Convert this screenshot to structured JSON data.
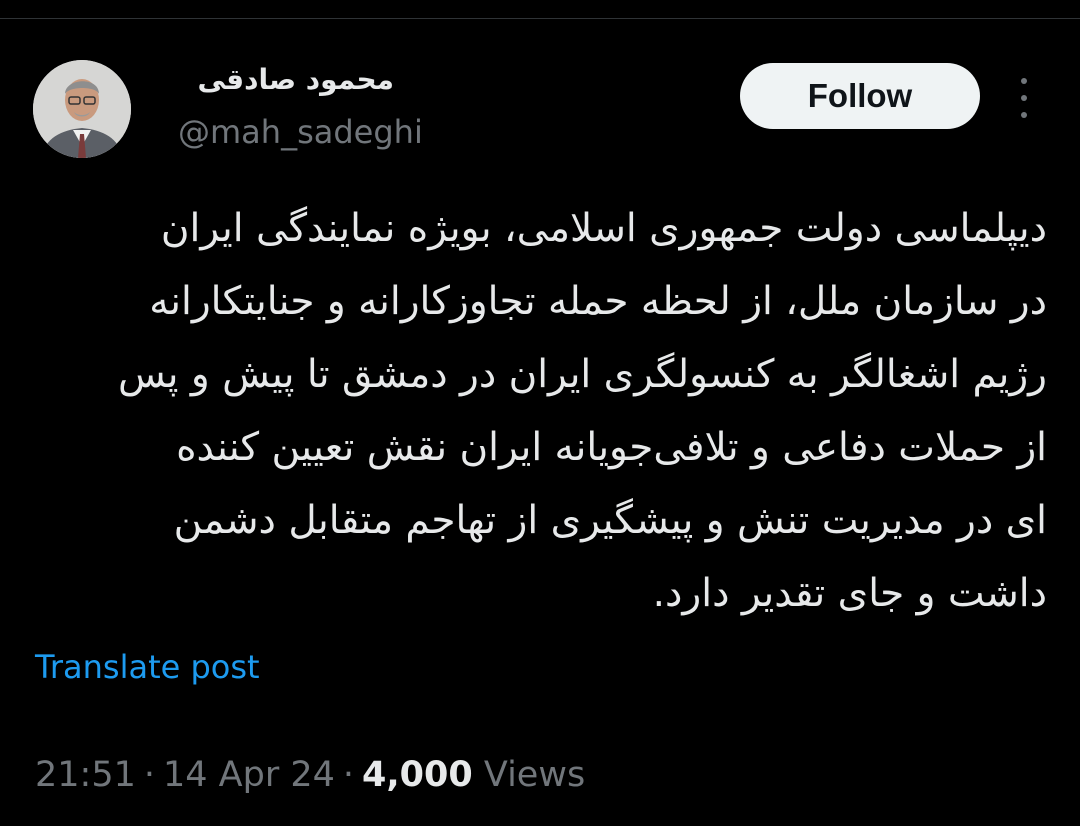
{
  "author": {
    "display_name": "محمود صادقی",
    "handle": "@mah_sadeghi",
    "avatar_icon": "user-avatar-photo"
  },
  "actions": {
    "follow_label": "Follow",
    "more_icon": "more-vertical-icon"
  },
  "tweet": {
    "text": "دیپلماسی دولت جمهوری اسلامی، بویژه نمایندگی ایران\nدر سازمان ملل، از لحظه حمله تجاوزکارانه و جنایتکارانه\nرژیم اشغالگر به کنسولگری ایران در دمشق تا پیش و پس\nاز حملات دفاعی و تلافی‌جویانه ایران نقش تعیین کننده\nای در مدیریت تنش و پیشگیری از تهاجم متقابل دشمن\nداشت و جای تقدیر دارد.",
    "translate_label": "Translate post"
  },
  "meta": {
    "time": "21:51",
    "date": "14 Apr 24",
    "separator": "·",
    "views_count": "4,000",
    "views_label": "Views"
  },
  "colors": {
    "background": "#000000",
    "text_primary": "#e7e9ea",
    "text_secondary": "#71767b",
    "link": "#1d9bf0",
    "follow_bg": "#eff3f4"
  }
}
